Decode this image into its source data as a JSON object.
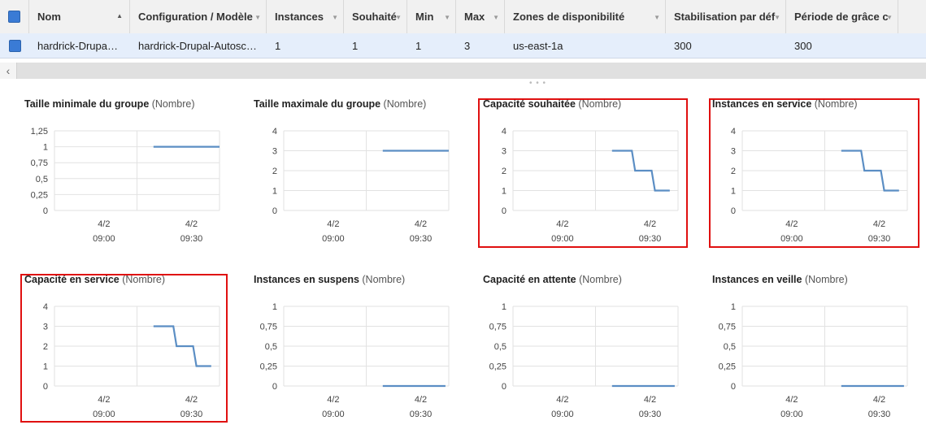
{
  "grid": {
    "columns": [
      {
        "label": "",
        "kind": "checkbox"
      },
      {
        "label": "Nom",
        "sort": "asc"
      },
      {
        "label": "Configuration / Modèle"
      },
      {
        "label": "Instances"
      },
      {
        "label": "Souhaité"
      },
      {
        "label": "Min"
      },
      {
        "label": "Max"
      },
      {
        "label": "Zones de disponibilité"
      },
      {
        "label": "Stabilisation par déf"
      },
      {
        "label": "Période de grâce c"
      }
    ],
    "rows": [
      {
        "selected": true,
        "cells": [
          "hardrick-Drupa…",
          "hardrick-Drupal-Autosc…",
          "1",
          "1",
          "1",
          "3",
          "us-east-1a",
          "300",
          "300"
        ]
      }
    ]
  },
  "charts": [
    {
      "title": "Taille minimale du groupe",
      "unit": "(Nombre)",
      "highlighted": false,
      "yticks": [
        "1,25",
        "1",
        "0,75",
        "0,5",
        "0,25",
        "0"
      ],
      "xticks": [
        [
          "4/2",
          "09:00"
        ],
        [
          "4/2",
          "09:30"
        ]
      ],
      "chart_data": {
        "type": "line",
        "ylim": [
          0,
          1.25
        ],
        "series": [
          {
            "x": [
              0.6,
              1.0
            ],
            "y": [
              1,
              1
            ]
          }
        ]
      }
    },
    {
      "title": "Taille maximale du groupe",
      "unit": "(Nombre)",
      "highlighted": false,
      "yticks": [
        "4",
        "3",
        "2",
        "1",
        "0"
      ],
      "xticks": [
        [
          "4/2",
          "09:00"
        ],
        [
          "4/2",
          "09:30"
        ]
      ],
      "chart_data": {
        "type": "line",
        "ylim": [
          0,
          4
        ],
        "series": [
          {
            "x": [
              0.6,
              1.0
            ],
            "y": [
              3,
              3
            ]
          }
        ]
      }
    },
    {
      "title": "Capacité souhaitée",
      "unit": "(Nombre)",
      "highlighted": true,
      "yticks": [
        "4",
        "3",
        "2",
        "1",
        "0"
      ],
      "xticks": [
        [
          "4/2",
          "09:00"
        ],
        [
          "4/2",
          "09:30"
        ]
      ],
      "chart_data": {
        "type": "line",
        "ylim": [
          0,
          4
        ],
        "series": [
          {
            "x": [
              0.6,
              0.72,
              0.74,
              0.84,
              0.86,
              0.95
            ],
            "y": [
              3,
              3,
              2,
              2,
              1,
              1
            ]
          }
        ]
      }
    },
    {
      "title": "Instances en service",
      "unit": "(Nombre)",
      "highlighted": true,
      "yticks": [
        "4",
        "3",
        "2",
        "1",
        "0"
      ],
      "xticks": [
        [
          "4/2",
          "09:00"
        ],
        [
          "4/2",
          "09:30"
        ]
      ],
      "chart_data": {
        "type": "line",
        "ylim": [
          0,
          4
        ],
        "series": [
          {
            "x": [
              0.6,
              0.72,
              0.74,
              0.84,
              0.86,
              0.95
            ],
            "y": [
              3,
              3,
              2,
              2,
              1,
              1
            ]
          }
        ]
      }
    },
    {
      "title": "Capacité en service",
      "unit": "(Nombre)",
      "highlighted": true,
      "yticks": [
        "4",
        "3",
        "2",
        "1",
        "0"
      ],
      "xticks": [
        [
          "4/2",
          "09:00"
        ],
        [
          "4/2",
          "09:30"
        ]
      ],
      "chart_data": {
        "type": "line",
        "ylim": [
          0,
          4
        ],
        "series": [
          {
            "x": [
              0.6,
              0.72,
              0.74,
              0.84,
              0.86,
              0.95
            ],
            "y": [
              3,
              3,
              2,
              2,
              1,
              1
            ]
          }
        ]
      }
    },
    {
      "title": "Instances en suspens",
      "unit": "(Nombre)",
      "highlighted": false,
      "yticks": [
        "1",
        "0,75",
        "0,5",
        "0,25",
        "0"
      ],
      "xticks": [
        [
          "4/2",
          "09:00"
        ],
        [
          "4/2",
          "09:30"
        ]
      ],
      "chart_data": {
        "type": "line",
        "ylim": [
          0,
          1
        ],
        "series": [
          {
            "x": [
              0.6,
              0.98
            ],
            "y": [
              0,
              0
            ]
          }
        ]
      }
    },
    {
      "title": "Capacité en attente",
      "unit": "(Nombre)",
      "highlighted": false,
      "yticks": [
        "1",
        "0,75",
        "0,5",
        "0,25",
        "0"
      ],
      "xticks": [
        [
          "4/2",
          "09:00"
        ],
        [
          "4/2",
          "09:30"
        ]
      ],
      "chart_data": {
        "type": "line",
        "ylim": [
          0,
          1
        ],
        "series": [
          {
            "x": [
              0.6,
              0.98
            ],
            "y": [
              0,
              0
            ]
          }
        ]
      }
    },
    {
      "title": "Instances en veille",
      "unit": "(Nombre)",
      "highlighted": false,
      "yticks": [
        "1",
        "0,75",
        "0,5",
        "0,25",
        "0"
      ],
      "xticks": [
        [
          "4/2",
          "09:00"
        ],
        [
          "4/2",
          "09:30"
        ]
      ],
      "chart_data": {
        "type": "line",
        "ylim": [
          0,
          1
        ],
        "series": [
          {
            "x": [
              0.6,
              0.98
            ],
            "y": [
              0,
              0
            ]
          }
        ]
      }
    }
  ],
  "colors": {
    "line": "#5b8ec4",
    "grid": "#e2e2e2",
    "highlight": "#e01010"
  }
}
